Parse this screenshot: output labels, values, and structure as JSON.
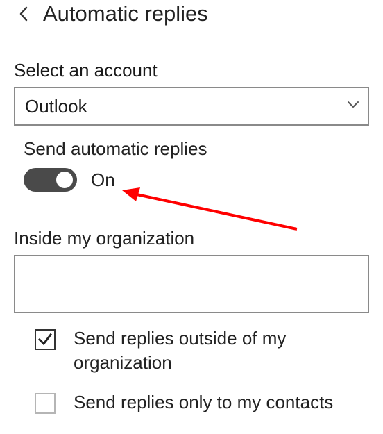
{
  "header": {
    "title": "Automatic replies"
  },
  "account": {
    "label": "Select an account",
    "selected": "Outlook"
  },
  "autoReplies": {
    "label": "Send automatic replies",
    "stateLabel": "On"
  },
  "insideOrg": {
    "label": "Inside my organization",
    "value": ""
  },
  "options": {
    "sendOutside": "Send replies outside of my organization",
    "sendContactsOnly": "Send replies only to my contacts"
  },
  "annotation": {
    "color": "#ff0000"
  }
}
